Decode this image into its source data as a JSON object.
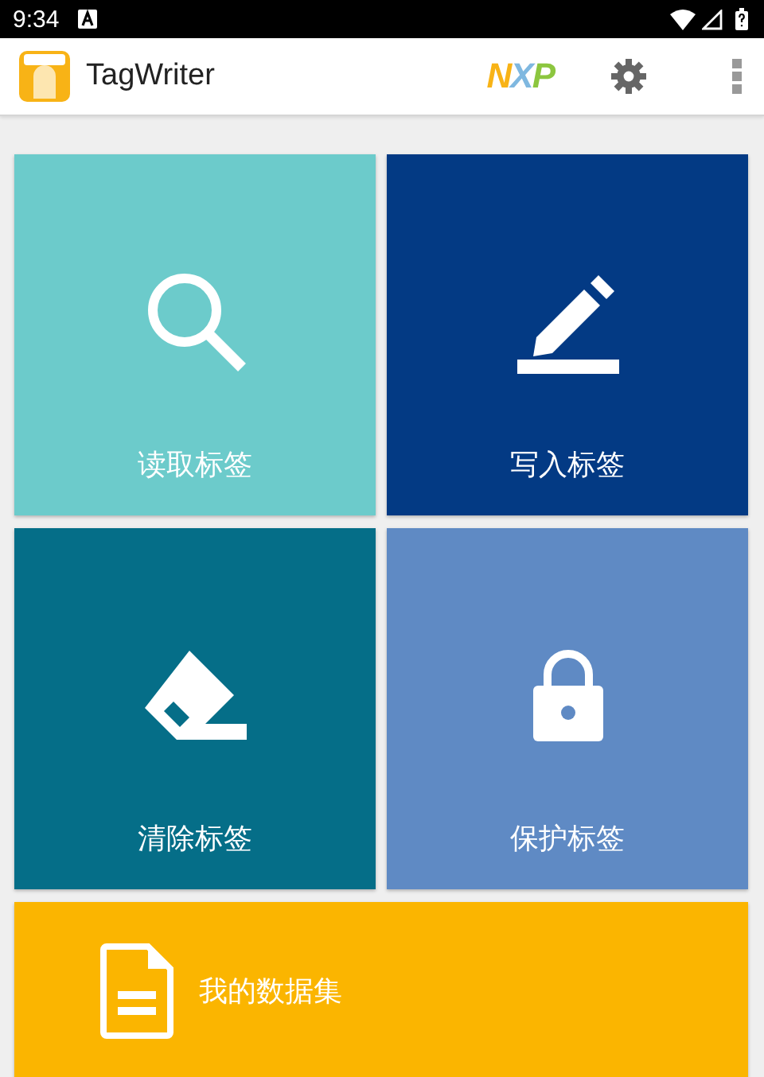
{
  "status_bar": {
    "time": "9:34"
  },
  "app_bar": {
    "title": "TagWriter",
    "logo": "NXP"
  },
  "tiles": [
    {
      "label": "读取标签",
      "kind": "read",
      "color": "#6ccbcb"
    },
    {
      "label": "写入标签",
      "kind": "write",
      "color": "#033a84"
    },
    {
      "label": "清除标签",
      "kind": "erase",
      "color": "#056e88"
    },
    {
      "label": "保护标签",
      "kind": "protect",
      "color": "#5f8ac4"
    }
  ],
  "datasets": {
    "label": "我的数据集",
    "kind": "datasets",
    "color": "#fbb500"
  }
}
